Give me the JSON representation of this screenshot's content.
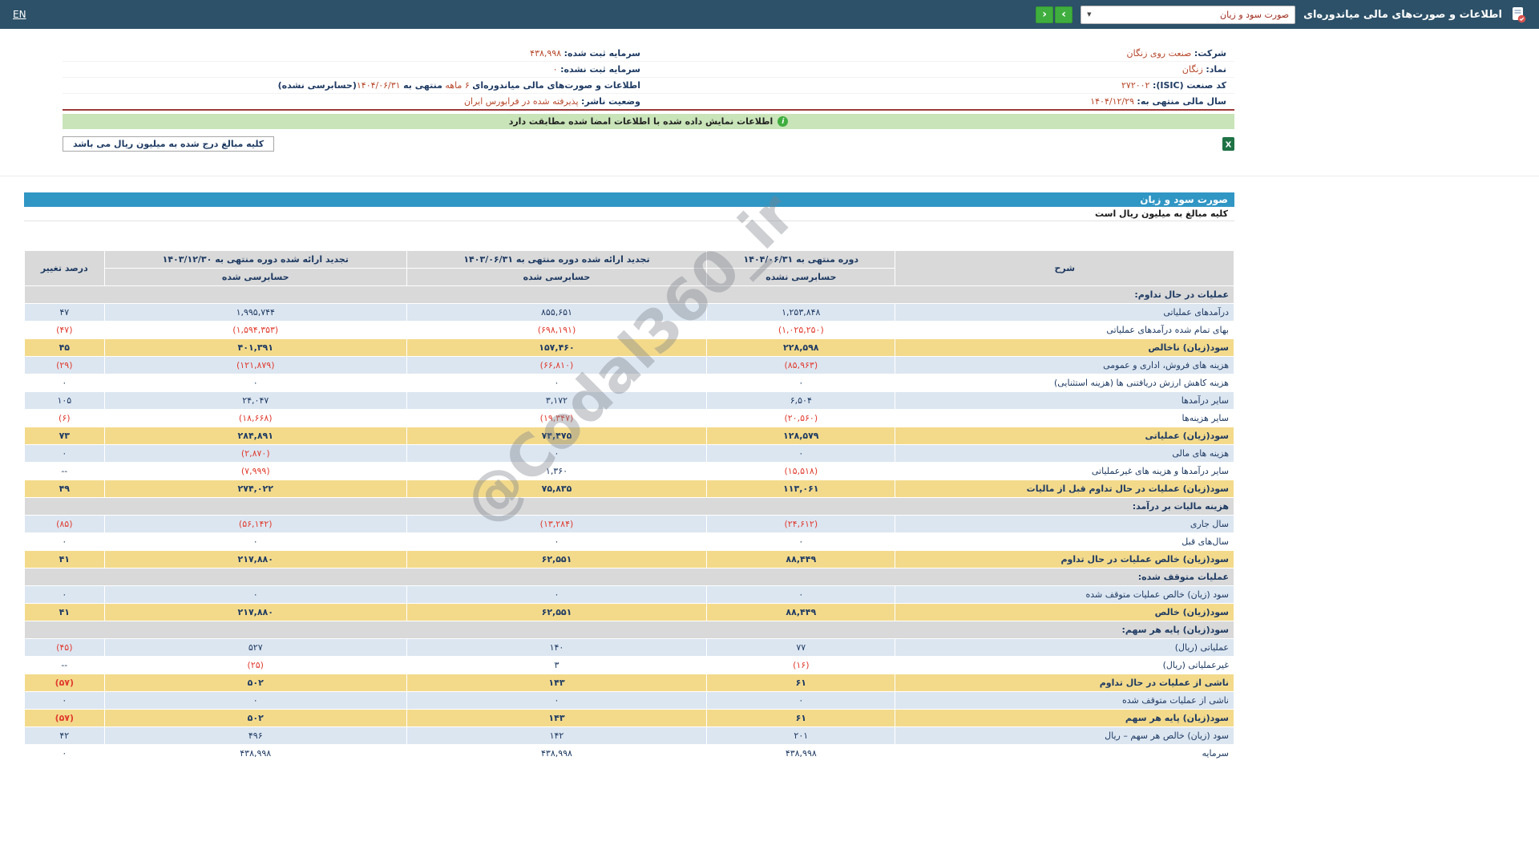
{
  "topbar": {
    "title": "اطلاعات و صورت‌های مالی میاندوره‌ای",
    "statement_selected": "صورت سود و زیان",
    "nav_right": "›",
    "nav_left": "‹",
    "lang": "EN"
  },
  "company": {
    "rows": [
      {
        "r_label": "شرکت:",
        "r_value": "صنعت روی زنگان",
        "l_label": "سرمایه ثبت شده:",
        "l_value": "۴۳۸,۹۹۸"
      },
      {
        "r_label": "نماد:",
        "r_value": "زنگان",
        "l_label": "سرمایه ثبت نشده:",
        "l_value": "۰"
      },
      {
        "r_label": "کد صنعت (ISIC):",
        "r_value": "۲۷۲۰۰۲"
      },
      {
        "r_label": "سال مالی منتهی به:",
        "r_value": "۱۴۰۴/۱۲/۲۹",
        "l_label": "وضعیت ناشر:",
        "l_value": "پذیرفته شده در فرابورس ایران"
      }
    ],
    "period_line": {
      "p1": "اطلاعات و صورت‌های مالی میاندوره‌ای",
      "p2": "۶ ماهه",
      "p3": "منتهی به",
      "p4": "۱۴۰۴/۰۶/۳۱",
      "p5": "(حسابرسی نشده)"
    }
  },
  "notices": {
    "signed_match": "اطلاعات نمایش داده شده با اطلاعات امضا شده مطابقت دارد",
    "info_icon_glyph": "i",
    "million_rial": "کلیه مبالغ درج شده به میلیون ریال می باشد",
    "excel_icon": "excel-export-icon"
  },
  "statement": {
    "title": "صورت سود و زیان",
    "subtitle": "کلیه مبالغ به میلیون ریال است",
    "columns": {
      "desc": "شرح",
      "pct": "درصد تغییر",
      "c1": {
        "title": "دوره منتهی به ۱۴۰۴/۰۶/۳۱",
        "sub": "حسابرسی نشده"
      },
      "c2": {
        "title": "تجدید ارائه شده دوره منتهی به ۱۴۰۳/۰۶/۳۱",
        "sub": "حسابرسی شده"
      },
      "c3": {
        "title": "تجدید ارائه شده دوره منتهی به ۱۴۰۳/۱۲/۳۰",
        "sub": "حسابرسی شده"
      }
    },
    "rows": [
      {
        "kind": "section",
        "label": "عملیات در حال تداوم:"
      },
      {
        "kind": "item",
        "label": "درآمدهای عملیاتی",
        "values": [
          "۱,۲۵۳,۸۴۸",
          "۸۵۵,۶۵۱",
          "۱,۹۹۵,۷۴۴",
          "۴۷"
        ]
      },
      {
        "kind": "item",
        "label": "بهای تمام شده درآمدهای عملیاتی",
        "values": [
          "(۱,۰۲۵,۲۵۰)",
          "(۶۹۸,۱۹۱)",
          "(۱,۵۹۴,۳۵۳)",
          "(۴۷)"
        ]
      },
      {
        "kind": "total",
        "label": "سود(زیان) ناخالص",
        "values": [
          "۲۲۸,۵۹۸",
          "۱۵۷,۴۶۰",
          "۴۰۱,۳۹۱",
          "۴۵"
        ]
      },
      {
        "kind": "item",
        "label": "هزینه های فروش، اداری و عمومی",
        "values": [
          "(۸۵,۹۶۳)",
          "(۶۶,۸۱۰)",
          "(۱۲۱,۸۷۹)",
          "(۲۹)"
        ]
      },
      {
        "kind": "item",
        "label": "هزینه کاهش ارزش دریافتنی ها (هزینه استثنایی)",
        "values": [
          "۰",
          "۰",
          "۰",
          "۰"
        ]
      },
      {
        "kind": "item",
        "label": "سایر درآمدها",
        "values": [
          "۶,۵۰۴",
          "۳,۱۷۲",
          "۲۴,۰۴۷",
          "۱۰۵"
        ]
      },
      {
        "kind": "item",
        "label": "سایر هزینه‌ها",
        "values": [
          "(۲۰,۵۶۰)",
          "(۱۹,۳۴۷)",
          "(۱۸,۶۶۸)",
          "(۶)"
        ]
      },
      {
        "kind": "total",
        "label": "سود(زیان) عملیاتی",
        "values": [
          "۱۲۸,۵۷۹",
          "۷۴,۴۷۵",
          "۲۸۴,۸۹۱",
          "۷۳"
        ]
      },
      {
        "kind": "item",
        "label": "هزینه های مالی",
        "values": [
          "۰",
          "۰",
          "(۲,۸۷۰)",
          "۰"
        ]
      },
      {
        "kind": "item",
        "label": "سایر درآمدها و هزینه های غیرعملیاتی",
        "values": [
          "(۱۵,۵۱۸)",
          "۱,۳۶۰",
          "(۷,۹۹۹)",
          "--"
        ]
      },
      {
        "kind": "total",
        "label": "سود(زیان) عملیات در حال تداوم قبل از مالیات",
        "values": [
          "۱۱۳,۰۶۱",
          "۷۵,۸۳۵",
          "۲۷۴,۰۲۲",
          "۴۹"
        ]
      },
      {
        "kind": "section",
        "label": "هزینه مالیات بر درآمد:"
      },
      {
        "kind": "item",
        "label": "سال جاری",
        "values": [
          "(۲۴,۶۱۲)",
          "(۱۳,۲۸۴)",
          "(۵۶,۱۴۲)",
          "(۸۵)"
        ]
      },
      {
        "kind": "item",
        "label": "سال‌های قبل",
        "values": [
          "۰",
          "۰",
          "۰",
          "۰"
        ]
      },
      {
        "kind": "total",
        "label": "سود(زیان) خالص عملیات در حال تداوم",
        "values": [
          "۸۸,۴۴۹",
          "۶۲,۵۵۱",
          "۲۱۷,۸۸۰",
          "۴۱"
        ]
      },
      {
        "kind": "section",
        "label": "عملیات متوقف شده:"
      },
      {
        "kind": "item",
        "label": "سود (زیان) خالص عملیات متوقف شده",
        "values": [
          "۰",
          "۰",
          "۰",
          "۰"
        ]
      },
      {
        "kind": "total",
        "label": "سود(زیان) خالص",
        "values": [
          "۸۸,۴۴۹",
          "۶۲,۵۵۱",
          "۲۱۷,۸۸۰",
          "۴۱"
        ]
      },
      {
        "kind": "section",
        "label": "سود(زیان) پایه هر سهم:"
      },
      {
        "kind": "item",
        "label": "عملیاتی (ریال)",
        "values": [
          "۷۷",
          "۱۴۰",
          "۵۲۷",
          "(۴۵)"
        ]
      },
      {
        "kind": "item",
        "label": "غیرعملیاتی (ریال)",
        "values": [
          "(۱۶)",
          "۳",
          "(۲۵)",
          "--"
        ]
      },
      {
        "kind": "total",
        "label": "ناشی از عملیات در حال تداوم",
        "values": [
          "۶۱",
          "۱۴۳",
          "۵۰۲",
          "(۵۷)"
        ]
      },
      {
        "kind": "item",
        "label": "ناشی از عملیات متوقف شده",
        "values": [
          "۰",
          "۰",
          "۰",
          "۰"
        ]
      },
      {
        "kind": "total",
        "label": "سود(زیان) پایه هر سهم",
        "values": [
          "۶۱",
          "۱۴۳",
          "۵۰۲",
          "(۵۷)"
        ]
      },
      {
        "kind": "item",
        "label": "سود (زیان) خالص هر سهم – ریال",
        "values": [
          "۲۰۱",
          "۱۴۲",
          "۴۹۶",
          "۴۲"
        ]
      },
      {
        "kind": "item",
        "label": "سرمایه",
        "values": [
          "۴۳۸,۹۹۸",
          "۴۳۸,۹۹۸",
          "۴۳۸,۹۹۸",
          "۰"
        ]
      }
    ]
  },
  "watermark": "@Codal360_ir",
  "colors": {
    "topbar_bg": "#2C5169",
    "title_bar_bg": "#3096C4",
    "section_row_bg": "#D9D9D9",
    "highlight_row_bg": "#F3DA8B",
    "alt_row_bg": "#DCE6F1",
    "negative_text": "#E03C2F",
    "primary_text": "#1F3B63",
    "accent_value_text": "#B7472A",
    "notice_bar_bg": "#C8E4B8",
    "nav_button_bg": "#3FAE3F",
    "divider_red": "#A03A3A"
  }
}
